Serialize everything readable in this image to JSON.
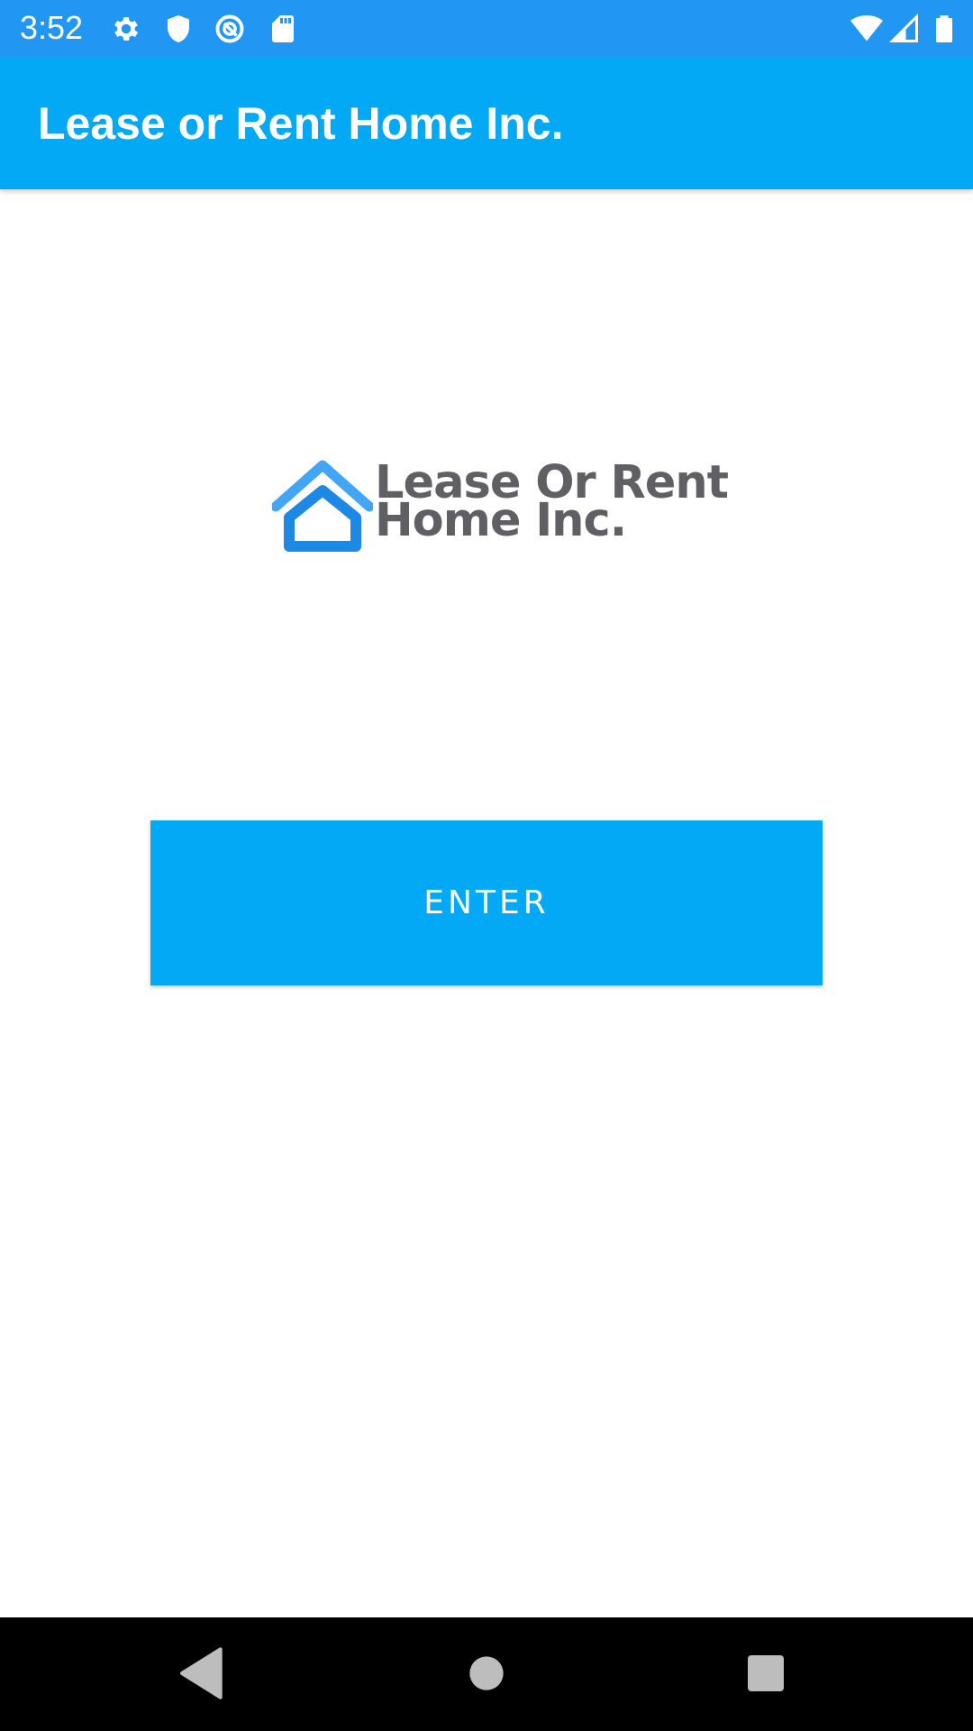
{
  "status_bar": {
    "time": "3:52",
    "background": "#2196F3",
    "left_icons": [
      "settings-icon",
      "shield-icon",
      "vpn-circle-icon",
      "sd-card-icon"
    ],
    "right_icons": [
      "wifi-icon",
      "cell-signal-icon",
      "battery-icon"
    ]
  },
  "app_bar": {
    "title": "Lease or Rent Home Inc.",
    "background": "#03A9F4"
  },
  "logo": {
    "line1": "Lease Or Rent",
    "line2": "Home Inc.",
    "text_color": "#5f5f64",
    "roof_color": "#42A5F5",
    "house_color": "#1E88E5"
  },
  "enter_button": {
    "label": "ENTER",
    "background": "#03A9F4"
  },
  "nav_bar": {
    "buttons": [
      "back-icon",
      "home-icon",
      "recents-icon"
    ]
  }
}
